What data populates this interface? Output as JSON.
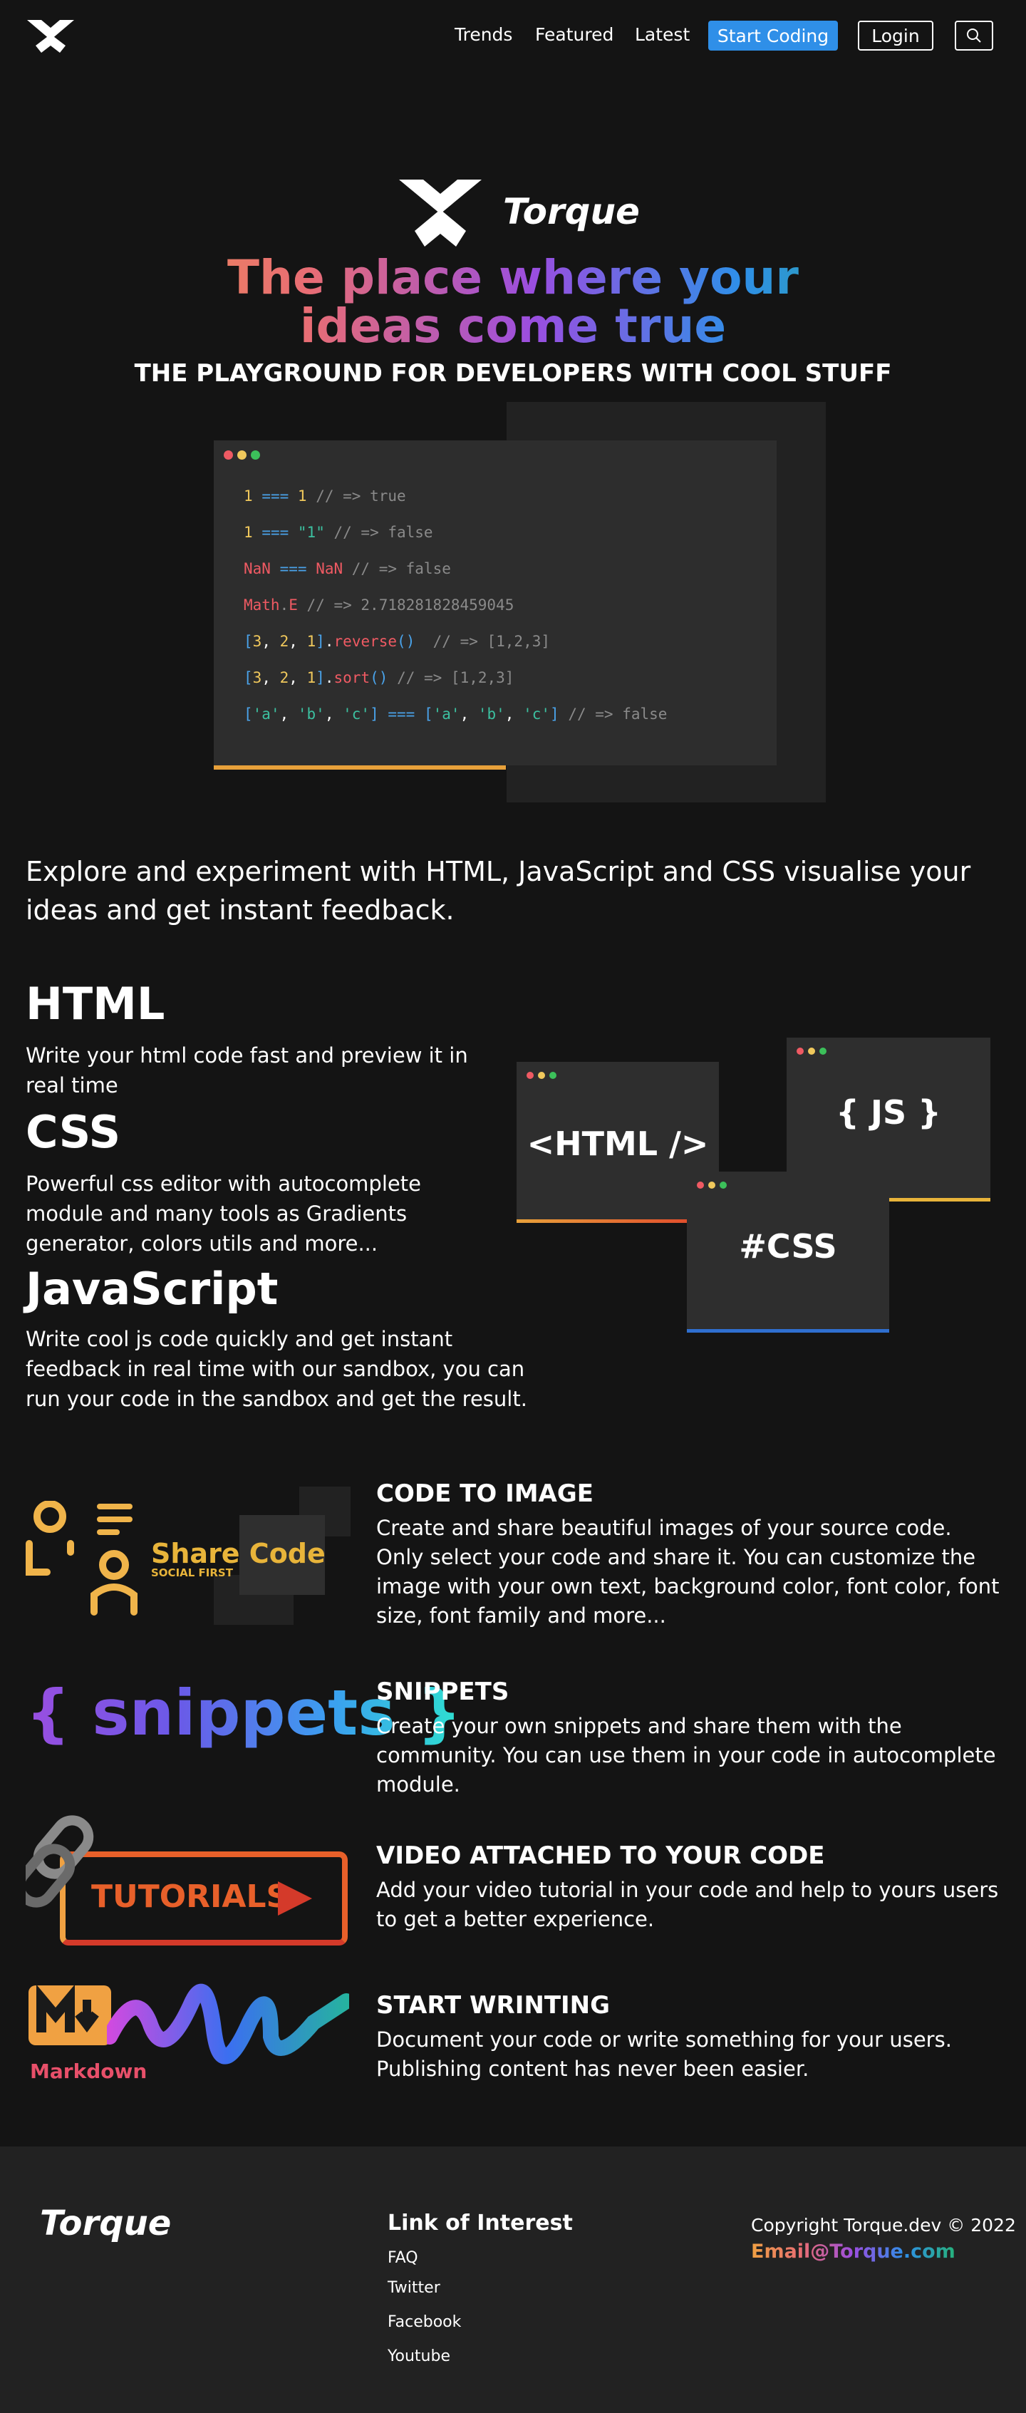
{
  "nav": {
    "links": [
      "Trends",
      "Featured",
      "Latest"
    ],
    "start_coding": "Start Coding",
    "login": "Login",
    "search_icon": "search-icon"
  },
  "hero": {
    "brand": "Torque",
    "headline_line1": "The place where your",
    "headline_line2": "ideas come true",
    "subheadline": "THE PLAYGROUND FOR DEVELOPERS WITH COOL STUFF"
  },
  "code_window": {
    "dot_colors": [
      "#ef5a63",
      "#f0c85c",
      "#3cc05a"
    ],
    "accent": "#e8a13a"
  },
  "explore_text": "Explore and experiment with HTML, JavaScript and CSS visualise your ideas and get instant feedback.",
  "features": [
    {
      "title": "HTML",
      "text": "Write your html code fast and preview it in real time"
    },
    {
      "title": "CSS",
      "text": "Powerful css editor with autocomplete module and many tools as Gradients generator, colors utils and more..."
    },
    {
      "title": "JavaScript",
      "text": "Write cool js code quickly and get instant feedback in real time with our sandbox, you can run your code in the sandbox and get the result."
    }
  ],
  "panels": {
    "html": "<HTML />",
    "js": "{ JS }",
    "css": "#CSS"
  },
  "sections": [
    {
      "title": "CODE TO IMAGE",
      "text": "Create and share beautiful images of your source code. Only select your code and share it. You can customize the image with your own text, background color, font color, font size, font family and more..."
    },
    {
      "title": "SNIPPETS",
      "text": "Create your own snippets and share them with the community. You can use them in your code in autocomplete module."
    },
    {
      "title": "VIDEO ATTACHED TO YOUR CODE",
      "text": "Add your video tutorial in your code and help to yours users to get a better experience."
    },
    {
      "title": "START WRINTING",
      "text": "Document your code or write something for your users. Publishing content has never been easier."
    }
  ],
  "illustrations": {
    "share_code": "Share Code",
    "social_first": "SOCIAL FIRST",
    "snippets": "{ snippets }",
    "tutorials": "TUTORIALS",
    "markdown": "Markdown"
  },
  "footer": {
    "brand": "Torque",
    "links_title": "Link of Interest",
    "links": [
      "FAQ",
      "Twitter",
      "Facebook",
      "Youtube"
    ],
    "copyright": "Copyright Torque.dev © 2022",
    "email": "Email@Torque.com"
  }
}
